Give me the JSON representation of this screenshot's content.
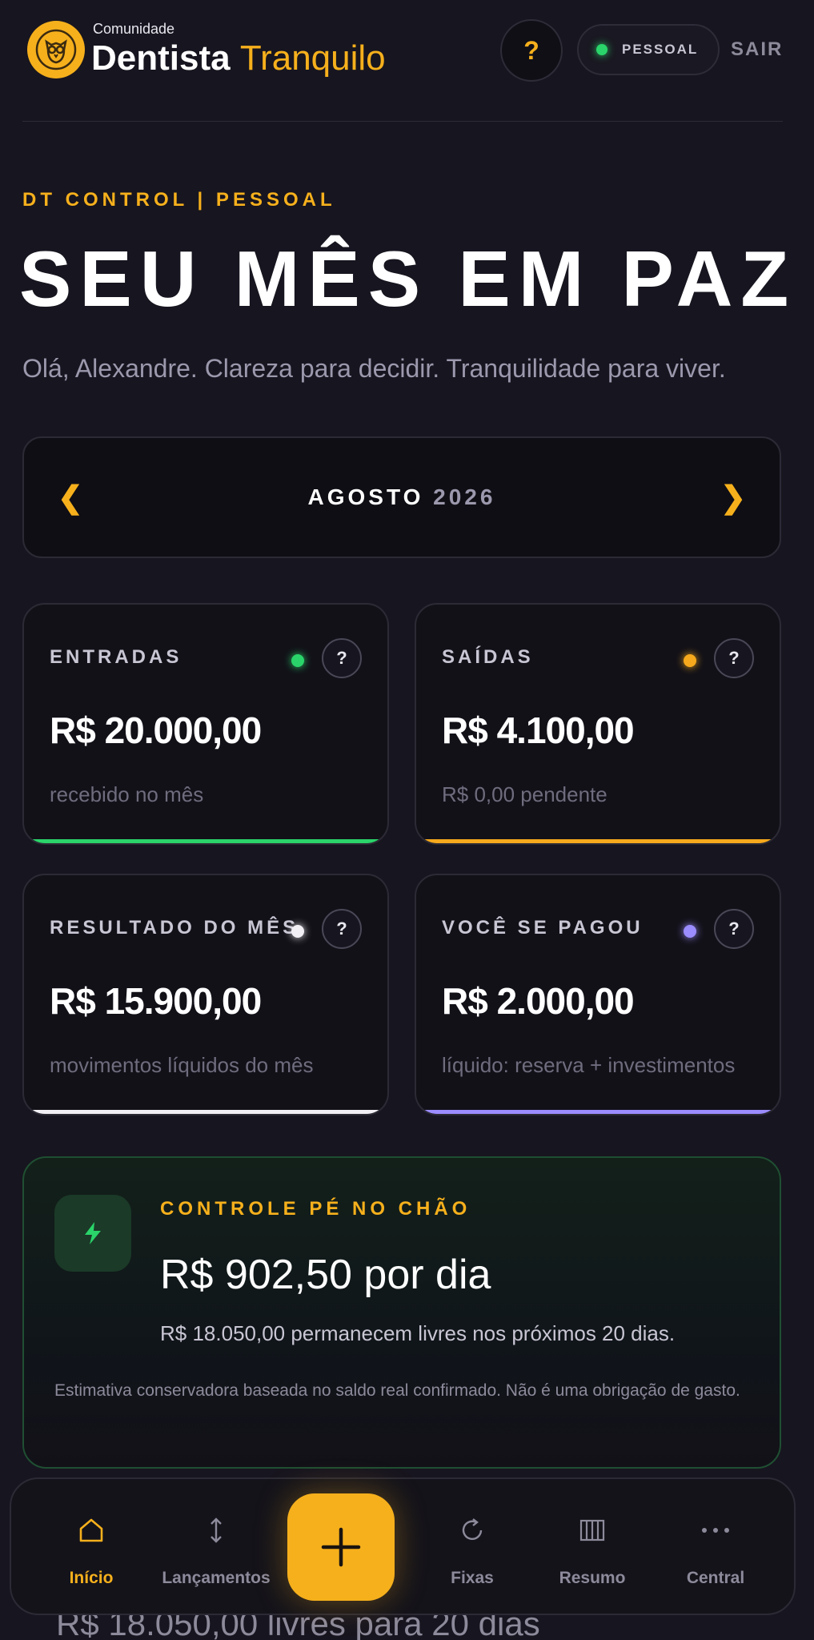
{
  "header": {
    "brand_small": "Comunidade",
    "brand_main_1": "Dentista",
    "brand_main_2": "Tranquilo",
    "help_label": "?",
    "mode_label": "PESSOAL",
    "logout_label": "SAIR"
  },
  "hero": {
    "eyebrow": "DT CONTROL | PESSOAL",
    "title": "SEU MÊS EM PAZ",
    "subtitle": "Olá, Alexandre. Clareza para decidir. Tranquilidade para viver."
  },
  "month": {
    "prev_icon": "chevron-left-icon",
    "next_icon": "chevron-right-icon",
    "prev_glyph": "❮",
    "next_glyph": "❯",
    "month_name": "AGOSTO",
    "year": "2026"
  },
  "cards": [
    {
      "label": "ENTRADAS",
      "value": "R$ 20.000,00",
      "caption": "recebido no mês",
      "dot_color": "#2ad46a",
      "bar_color": "#2ad46a",
      "help": "?"
    },
    {
      "label": "SAÍDAS",
      "value": "R$ 4.100,00",
      "caption": "R$ 0,00 pendente",
      "dot_color": "#f6a91c",
      "bar_color": "#f6a91c",
      "help": "?"
    },
    {
      "label": "RESULTADO DO MÊS",
      "value": "R$ 15.900,00",
      "caption": "movimentos líquidos do mês",
      "dot_color": "#f2f0f5",
      "bar_color": "#f2f0f5",
      "help": "?"
    },
    {
      "label": "VOCÊ SE PAGOU",
      "value": "R$ 2.000,00",
      "caption": "líquido: reserva + investimentos",
      "dot_color": "#9b8cff",
      "bar_color": "#9b8cff",
      "help": "?"
    }
  ],
  "controle": {
    "icon": "bolt-icon",
    "eyebrow": "CONTROLE PÉ NO CHÃO",
    "value": "R$ 902,50 por dia",
    "subtitle": "R$ 18.050,00 permanecem livres nos próximos 20 dias.",
    "note": "Estimativa conservadora baseada no saldo real confirmado. Não é uma obrigação de gasto."
  },
  "peek_text": "R$ 18.050,00 livres para 20 dias",
  "nav": {
    "items": [
      {
        "label": "Início",
        "icon": "home-icon"
      },
      {
        "label": "Lançamentos",
        "icon": "arrows-vertical-icon"
      },
      {
        "label": "Fixas",
        "icon": "refresh-icon"
      },
      {
        "label": "Resumo",
        "icon": "columns-icon"
      },
      {
        "label": "Central",
        "icon": "more-icon"
      }
    ],
    "add_icon": "plus-icon",
    "active": "Início"
  },
  "colors": {
    "accent": "#f6b01c",
    "background": "#17151f",
    "positive": "#2ad46a"
  }
}
